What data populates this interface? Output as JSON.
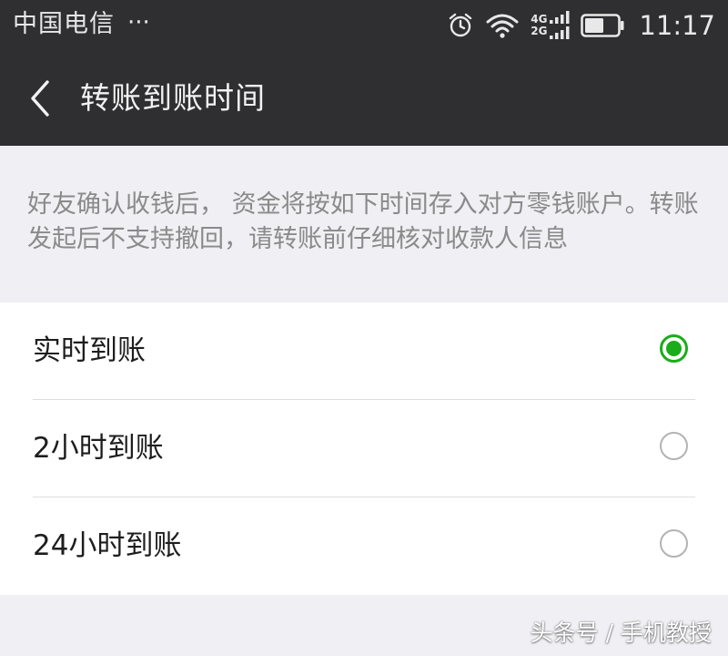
{
  "status_bar": {
    "carrier": "中国电信",
    "more_indicator": "···",
    "network_top": "4G",
    "network_bottom": "2G",
    "time": "11:17",
    "icons": [
      "alarm-icon",
      "wifi-icon",
      "signal-icon",
      "battery-icon"
    ]
  },
  "nav": {
    "back_icon": "chevron-left-icon",
    "title": "转账到账时间"
  },
  "notice": "好友确认收钱后，  资金将按如下时间存入对方零钱账户。转账发起后不支持撤回，请转账前仔细核对收款人信息",
  "options": [
    {
      "label": "实时到账",
      "selected": true
    },
    {
      "label": "2小时到账",
      "selected": false
    },
    {
      "label": "24小时到账",
      "selected": false
    }
  ],
  "watermark": "头条号 / 手机教授",
  "colors": {
    "header_bg": "#2f2f31",
    "page_bg": "#efeff4",
    "accent": "#1aad19",
    "notice_text": "#8a8a8a"
  }
}
